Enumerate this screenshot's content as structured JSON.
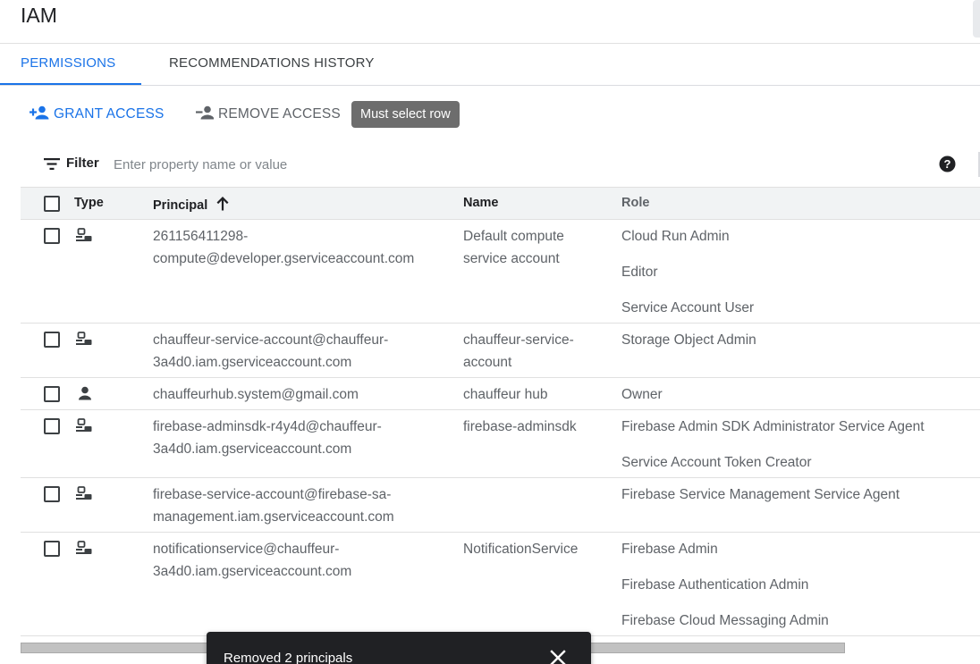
{
  "page": {
    "title": "IAM"
  },
  "tabs": [
    {
      "label": "PERMISSIONS",
      "active": true
    },
    {
      "label": "RECOMMENDATIONS HISTORY",
      "active": false
    }
  ],
  "toolbar": {
    "grant_label": "GRANT ACCESS",
    "grant_icon": "person-add-icon",
    "remove_label": "REMOVE ACCESS",
    "remove_icon": "person-remove-icon",
    "tooltip": "Must select row"
  },
  "filter": {
    "label": "Filter",
    "placeholder": "Enter property name or value",
    "value": ""
  },
  "table": {
    "columns": {
      "type": "Type",
      "principal": "Principal",
      "name": "Name",
      "role": "Role"
    },
    "sort": {
      "column": "Principal",
      "direction": "ascending"
    },
    "rows": [
      {
        "type_icon": "service-account-icon",
        "principal": "261156411298-compute@developer.gserviceaccount.com",
        "name": "Default compute service account",
        "roles": [
          "Cloud Run Admin",
          "Editor",
          "Service Account User"
        ]
      },
      {
        "type_icon": "service-account-icon",
        "principal": "chauffeur-service-account@chauffeur-3a4d0.iam.gserviceaccount.com",
        "name": "chauffeur-service-account",
        "roles": [
          "Storage Object Admin"
        ]
      },
      {
        "type_icon": "person-icon",
        "principal": "chauffeurhub.system@gmail.com",
        "name": "chauffeur hub",
        "roles": [
          "Owner"
        ]
      },
      {
        "type_icon": "service-account-icon",
        "principal": "firebase-adminsdk-r4y4d@chauffeur-3a4d0.iam.gserviceaccount.com",
        "name": "firebase-adminsdk",
        "roles": [
          "Firebase Admin SDK Administrator Service Agent",
          "Service Account Token Creator"
        ]
      },
      {
        "type_icon": "service-account-icon",
        "principal": "firebase-service-account@firebase-sa-management.iam.gserviceaccount.com",
        "name": "",
        "roles": [
          "Firebase Service Management Service Agent"
        ]
      },
      {
        "type_icon": "service-account-icon",
        "principal": "notificationservice@chauffeur-3a4d0.iam.gserviceaccount.com",
        "name": "NotificationService",
        "roles": [
          "Firebase Admin",
          "Firebase Authentication Admin",
          "Firebase Cloud Messaging Admin"
        ]
      }
    ]
  },
  "snackbar": {
    "message": "Removed 2 principals"
  },
  "colors": {
    "accent": "#1a73e8",
    "text": "#3c4043",
    "muted": "#5f6368",
    "header_bg": "#f1f3f4",
    "snackbar_bg": "#202124"
  }
}
